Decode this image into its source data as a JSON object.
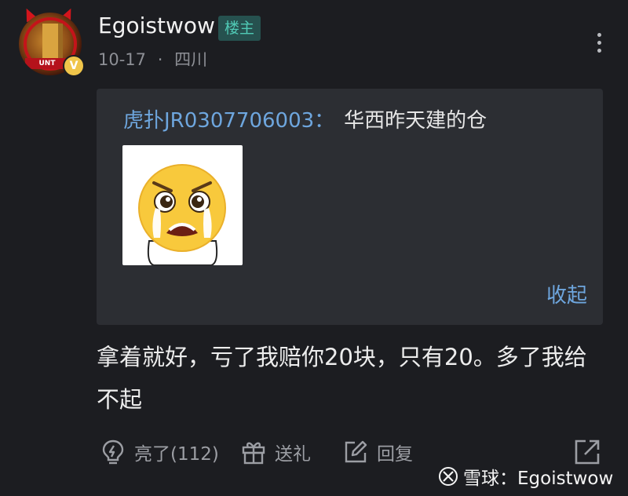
{
  "author": {
    "name": "Egoistwow",
    "badge": "楼主",
    "date": "10-17",
    "separator": "·",
    "location": "四川",
    "verified_mark": "V",
    "avatar_banner": "UNT"
  },
  "quote": {
    "user": "虎扑JR0307706003：",
    "text": "华西昨天建的仓",
    "image_icon": "crying-face-sticker",
    "collapse_label": "收起"
  },
  "post": {
    "text": "拿着就好，亏了我赔你20块，只有20。多了我给不起"
  },
  "actions": {
    "like_label": "亮了(112)",
    "gift_label": "送礼",
    "reply_label": "回复"
  },
  "watermark": {
    "text": "雪球：Egoistwow"
  },
  "colors": {
    "background": "#1c1d21",
    "quote_background": "#2c2e33",
    "link_blue": "#6ea6de",
    "badge_green": "#50c9b5",
    "muted": "#8d8f95"
  }
}
